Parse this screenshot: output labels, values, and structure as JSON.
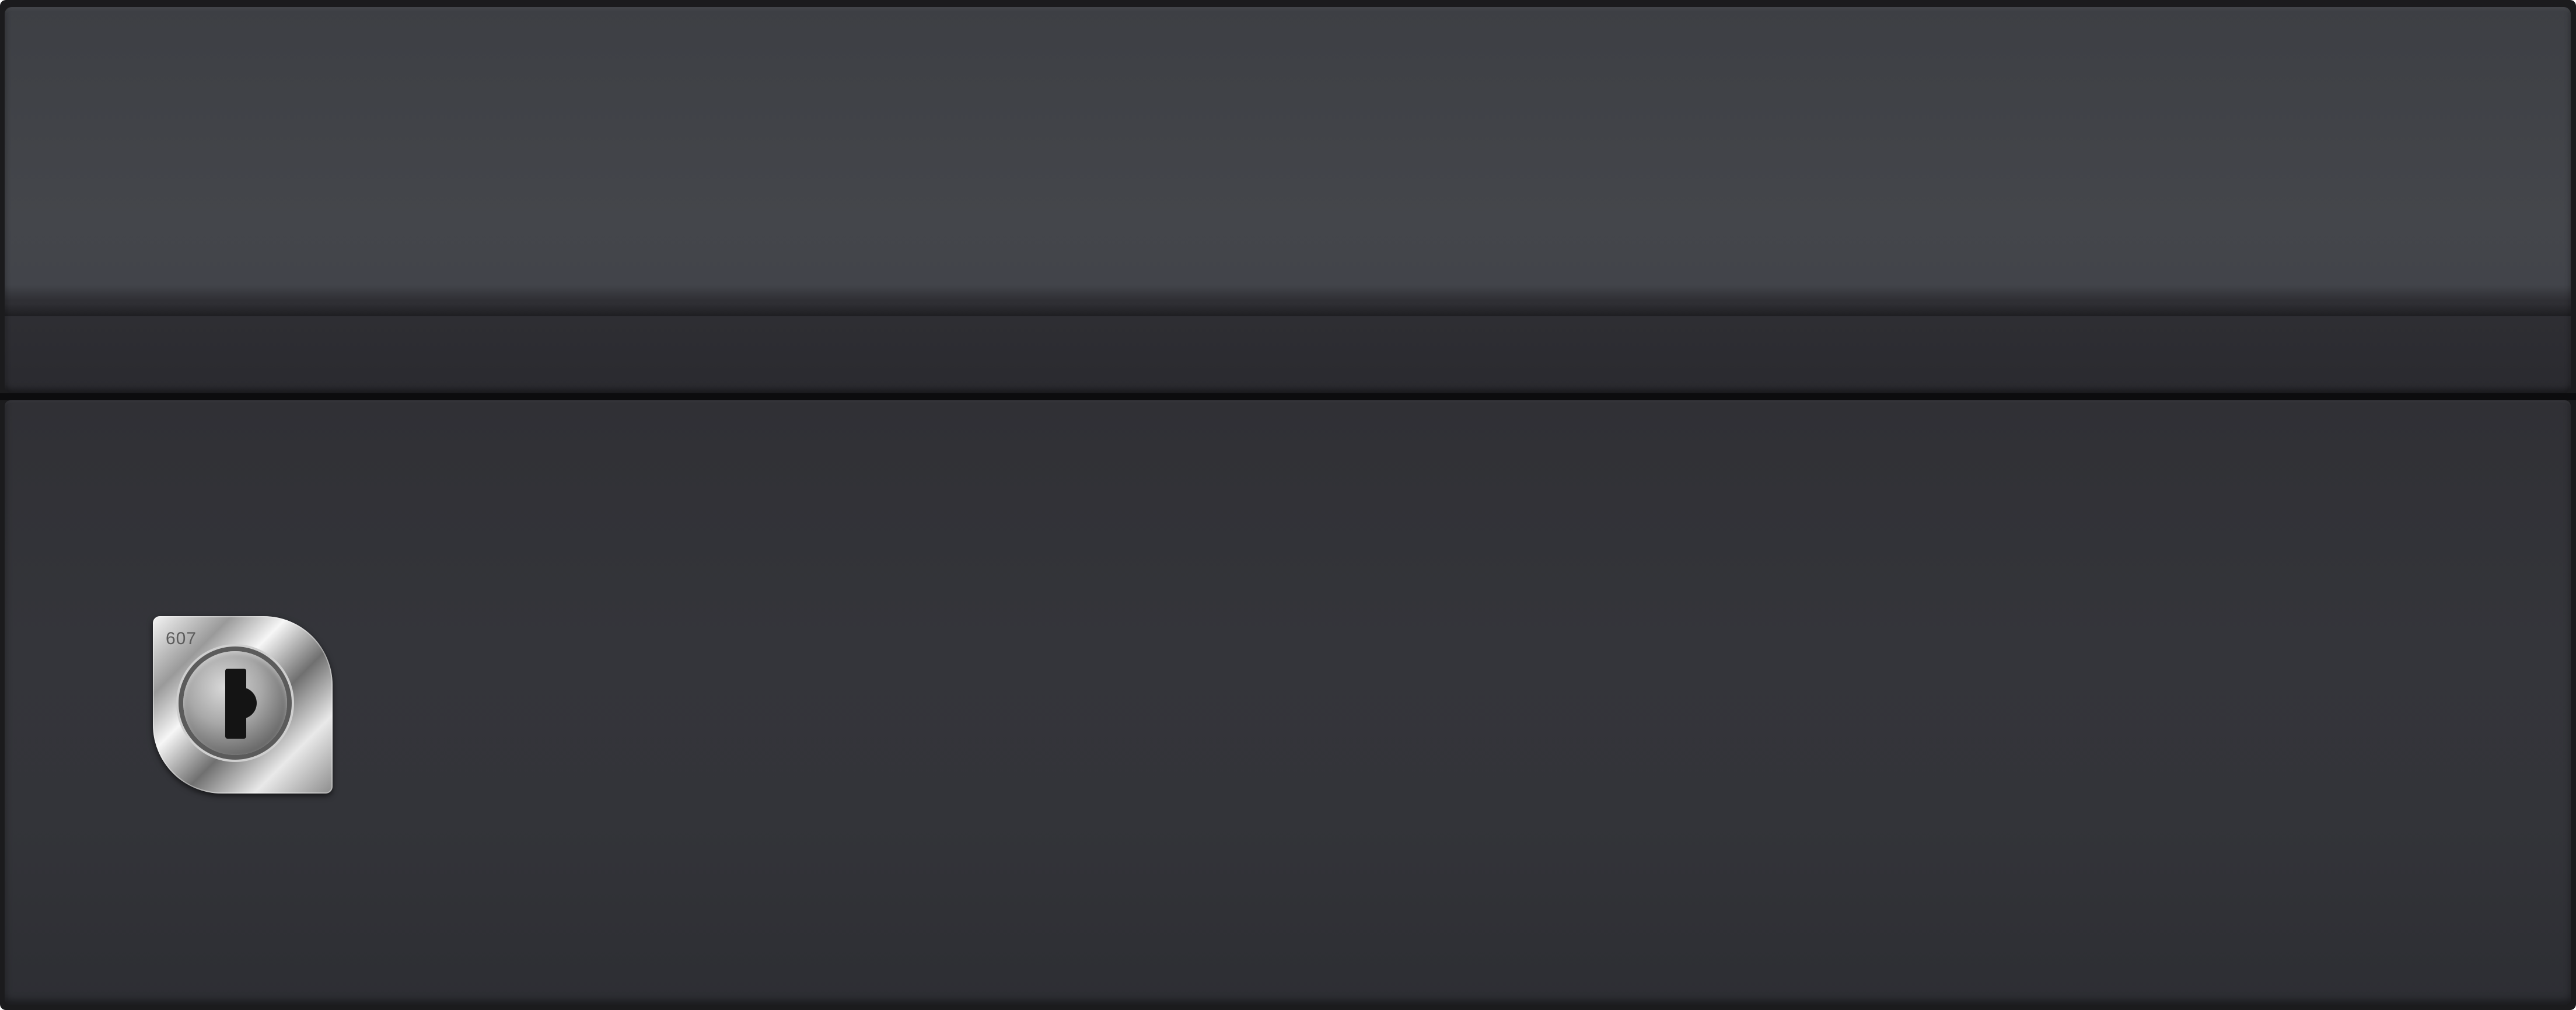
{
  "scene": {
    "subject": "cabinet-with-lock"
  },
  "lock": {
    "mark": "607"
  },
  "colors": {
    "lid": "#44464b",
    "body": "#333439",
    "edge": "#1b1b1d",
    "chrome": "#d9d9d9"
  }
}
